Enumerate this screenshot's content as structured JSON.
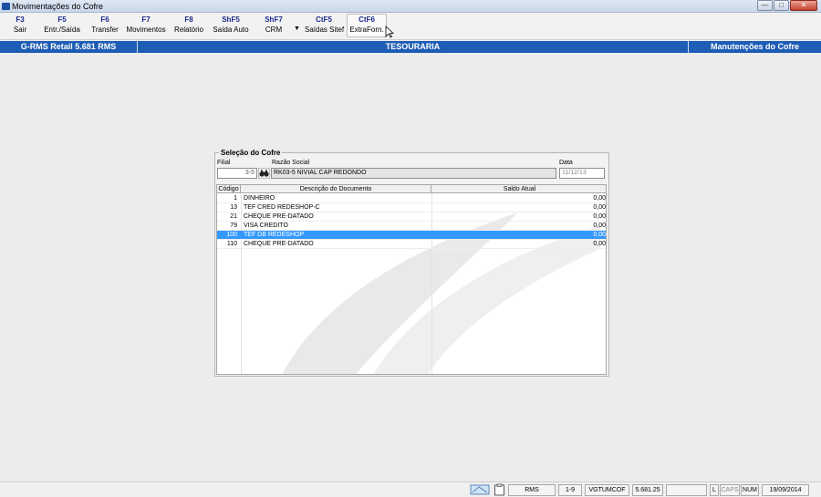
{
  "window": {
    "title": "Movimentações do Cofre",
    "buttons": {
      "minimize": "—",
      "maximize": "□",
      "close": "✕"
    }
  },
  "toolbar": {
    "buttons": [
      {
        "key": "F3",
        "label": "Sair"
      },
      {
        "key": "F5",
        "label": "Entr./Saída"
      },
      {
        "key": "F6",
        "label": "Transfer"
      },
      {
        "key": "F7",
        "label": "Movimentos"
      },
      {
        "key": "F8",
        "label": "Relatório"
      },
      {
        "key": "ShF5",
        "label": "Saída Auto"
      },
      {
        "key": "ShF7",
        "label": "CRM"
      },
      {
        "key": "CtF5",
        "label": "Saídas Sitef"
      },
      {
        "key": "CtF6",
        "label": "ExtraForn."
      }
    ],
    "dropdown_arrow": "▼"
  },
  "header": {
    "left": "G-RMS Retail 5.681 RMS",
    "center": "TESOURARIA",
    "right": "Manutenções do Cofre"
  },
  "selection": {
    "group_title": "Seleção do Cofre",
    "filial_label": "Filial",
    "filial_value": "3-5",
    "razao_label": "Razão Social",
    "razao_value": "RK03-5 NIVIAL CAP REDONDO",
    "data_label": "Data",
    "data_value": "11/12/13"
  },
  "grid": {
    "columns": [
      "Código",
      "Descrição do Documento",
      "Saldo Atual"
    ],
    "rows": [
      {
        "codigo": "1",
        "descricao": "DINHEIRO",
        "saldo": "0,00"
      },
      {
        "codigo": "13",
        "descricao": "TEF CRED REDESHOP-C",
        "saldo": "0,00"
      },
      {
        "codigo": "21",
        "descricao": "CHEQUE PRE-DATADO",
        "saldo": "0,00"
      },
      {
        "codigo": "79",
        "descricao": "VISA CREDITO",
        "saldo": "0,00"
      },
      {
        "codigo": "100",
        "descricao": "TEF DB REDESHOP",
        "saldo": "0,00"
      },
      {
        "codigo": "110",
        "descricao": "CHEQUE PRE-DATADO",
        "saldo": "0,00"
      }
    ],
    "selected_index": 4,
    "selection_color": "#3399ff"
  },
  "statusbar": {
    "system": "RMS",
    "page": "1-9",
    "program": "VGTUMCOF",
    "version": "5.681.25",
    "empty": "",
    "lock": "L",
    "caps": "CAPS",
    "num": "NUM",
    "date": "19/09/2014"
  },
  "colors": {
    "accent": "#1e5db5",
    "key_text": "#1a2a8a"
  }
}
